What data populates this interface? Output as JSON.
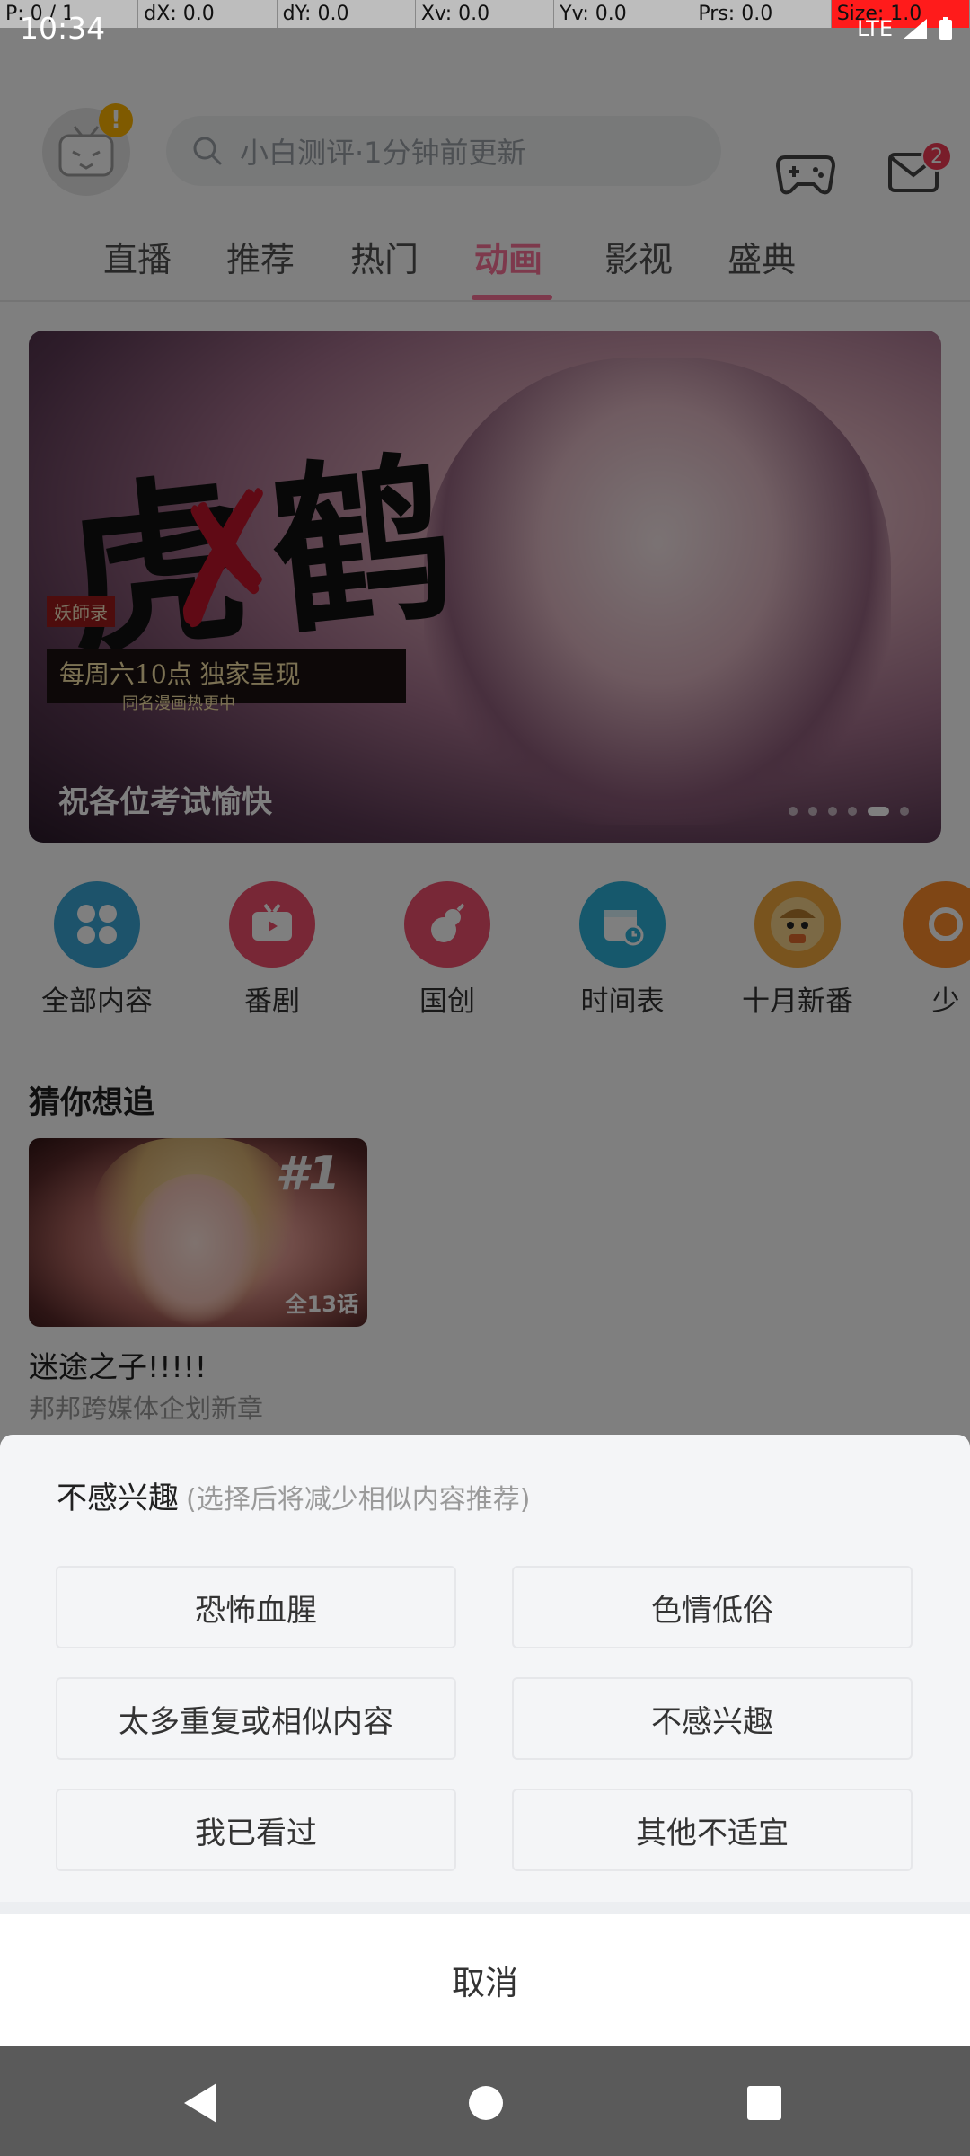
{
  "pointer_bar": {
    "p": "P: 0 / 1",
    "dx": "dX: 0.0",
    "dy": "dY: 0.0",
    "xv": "Xv: 0.0",
    "yv": "Yv: 0.0",
    "prs": "Prs: 0.0",
    "size": "Size: 1.0"
  },
  "status_bar": {
    "time": "10:34",
    "network": "LTE"
  },
  "header": {
    "avatar_badge": "!",
    "search_placeholder": "小白测评·1分钟前更新",
    "mail_badge": "2"
  },
  "tabs": [
    {
      "label": "直播"
    },
    {
      "label": "推荐"
    },
    {
      "label": "热门"
    },
    {
      "label": "动画",
      "active": true
    },
    {
      "label": "影视"
    },
    {
      "label": "盛典"
    }
  ],
  "banner": {
    "logo_tag": "妖師录",
    "strap_line": "每周六10点 独家呈现",
    "strap_sub": "同名漫画热更中",
    "caption": "祝各位考试愉快",
    "dots_count": 6,
    "active_dot": 4
  },
  "categories": [
    {
      "label": "全部内容",
      "icon": "grid-icon",
      "color": "#3aa7d6"
    },
    {
      "label": "番剧",
      "icon": "tv-icon",
      "color": "#f04f6c"
    },
    {
      "label": "国创",
      "icon": "gourd-icon",
      "color": "#f0506e"
    },
    {
      "label": "时间表",
      "icon": "calendar-icon",
      "color": "#2db0d8"
    },
    {
      "label": "十月新番",
      "icon": "mascot-icon",
      "color": "#f2a83c"
    },
    {
      "label": "少",
      "icon": "ring-icon",
      "color": "#ff8c2a"
    }
  ],
  "section": {
    "title": "猜你想追"
  },
  "card": {
    "rank": "#1",
    "episodes": "全13话",
    "title": "迷途之子!!!!!",
    "subtitle": "邦邦跨媒体企划新章"
  },
  "sheet": {
    "title": "不感兴趣",
    "subtitle": "(选择后将减少相似内容推荐)",
    "reasons": [
      "恐怖血腥",
      "色情低俗",
      "太多重复或相似内容",
      "不感兴趣",
      "我已看过",
      "其他不适宜"
    ],
    "cancel": "取消"
  }
}
